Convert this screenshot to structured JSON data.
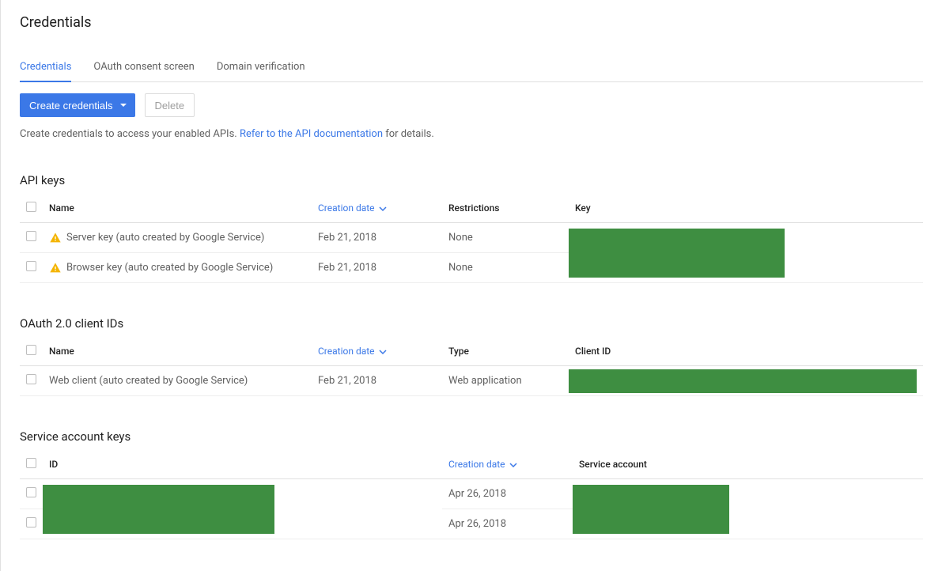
{
  "header": {
    "title": "Credentials"
  },
  "tabs": [
    {
      "label": "Credentials",
      "active": true
    },
    {
      "label": "OAuth consent screen",
      "active": false
    },
    {
      "label": "Domain verification",
      "active": false
    }
  ],
  "toolbar": {
    "create_label": "Create credentials",
    "delete_label": "Delete"
  },
  "helper": {
    "prefix": "Create credentials to access your enabled APIs. ",
    "link": "Refer to the API documentation",
    "suffix": " for details."
  },
  "sections": {
    "api_keys": {
      "title": "API keys",
      "headers": {
        "name": "Name",
        "date": "Creation date",
        "restrictions": "Restrictions",
        "key": "Key"
      },
      "rows": [
        {
          "name": "Server key (auto created by Google Service)",
          "date": "Feb 21, 2018",
          "restrictions": "None",
          "warn": true
        },
        {
          "name": "Browser key (auto created by Google Service)",
          "date": "Feb 21, 2018",
          "restrictions": "None",
          "warn": true
        }
      ]
    },
    "oauth": {
      "title": "OAuth 2.0 client IDs",
      "headers": {
        "name": "Name",
        "date": "Creation date",
        "type": "Type",
        "client_id": "Client ID"
      },
      "rows": [
        {
          "name": "Web client (auto created by Google Service)",
          "date": "Feb 21, 2018",
          "type": "Web application"
        }
      ]
    },
    "service": {
      "title": "Service account keys",
      "headers": {
        "id": "ID",
        "date": "Creation date",
        "account": "Service account"
      },
      "rows": [
        {
          "date": "Apr 26, 2018"
        },
        {
          "date": "Apr 26, 2018"
        }
      ]
    }
  }
}
